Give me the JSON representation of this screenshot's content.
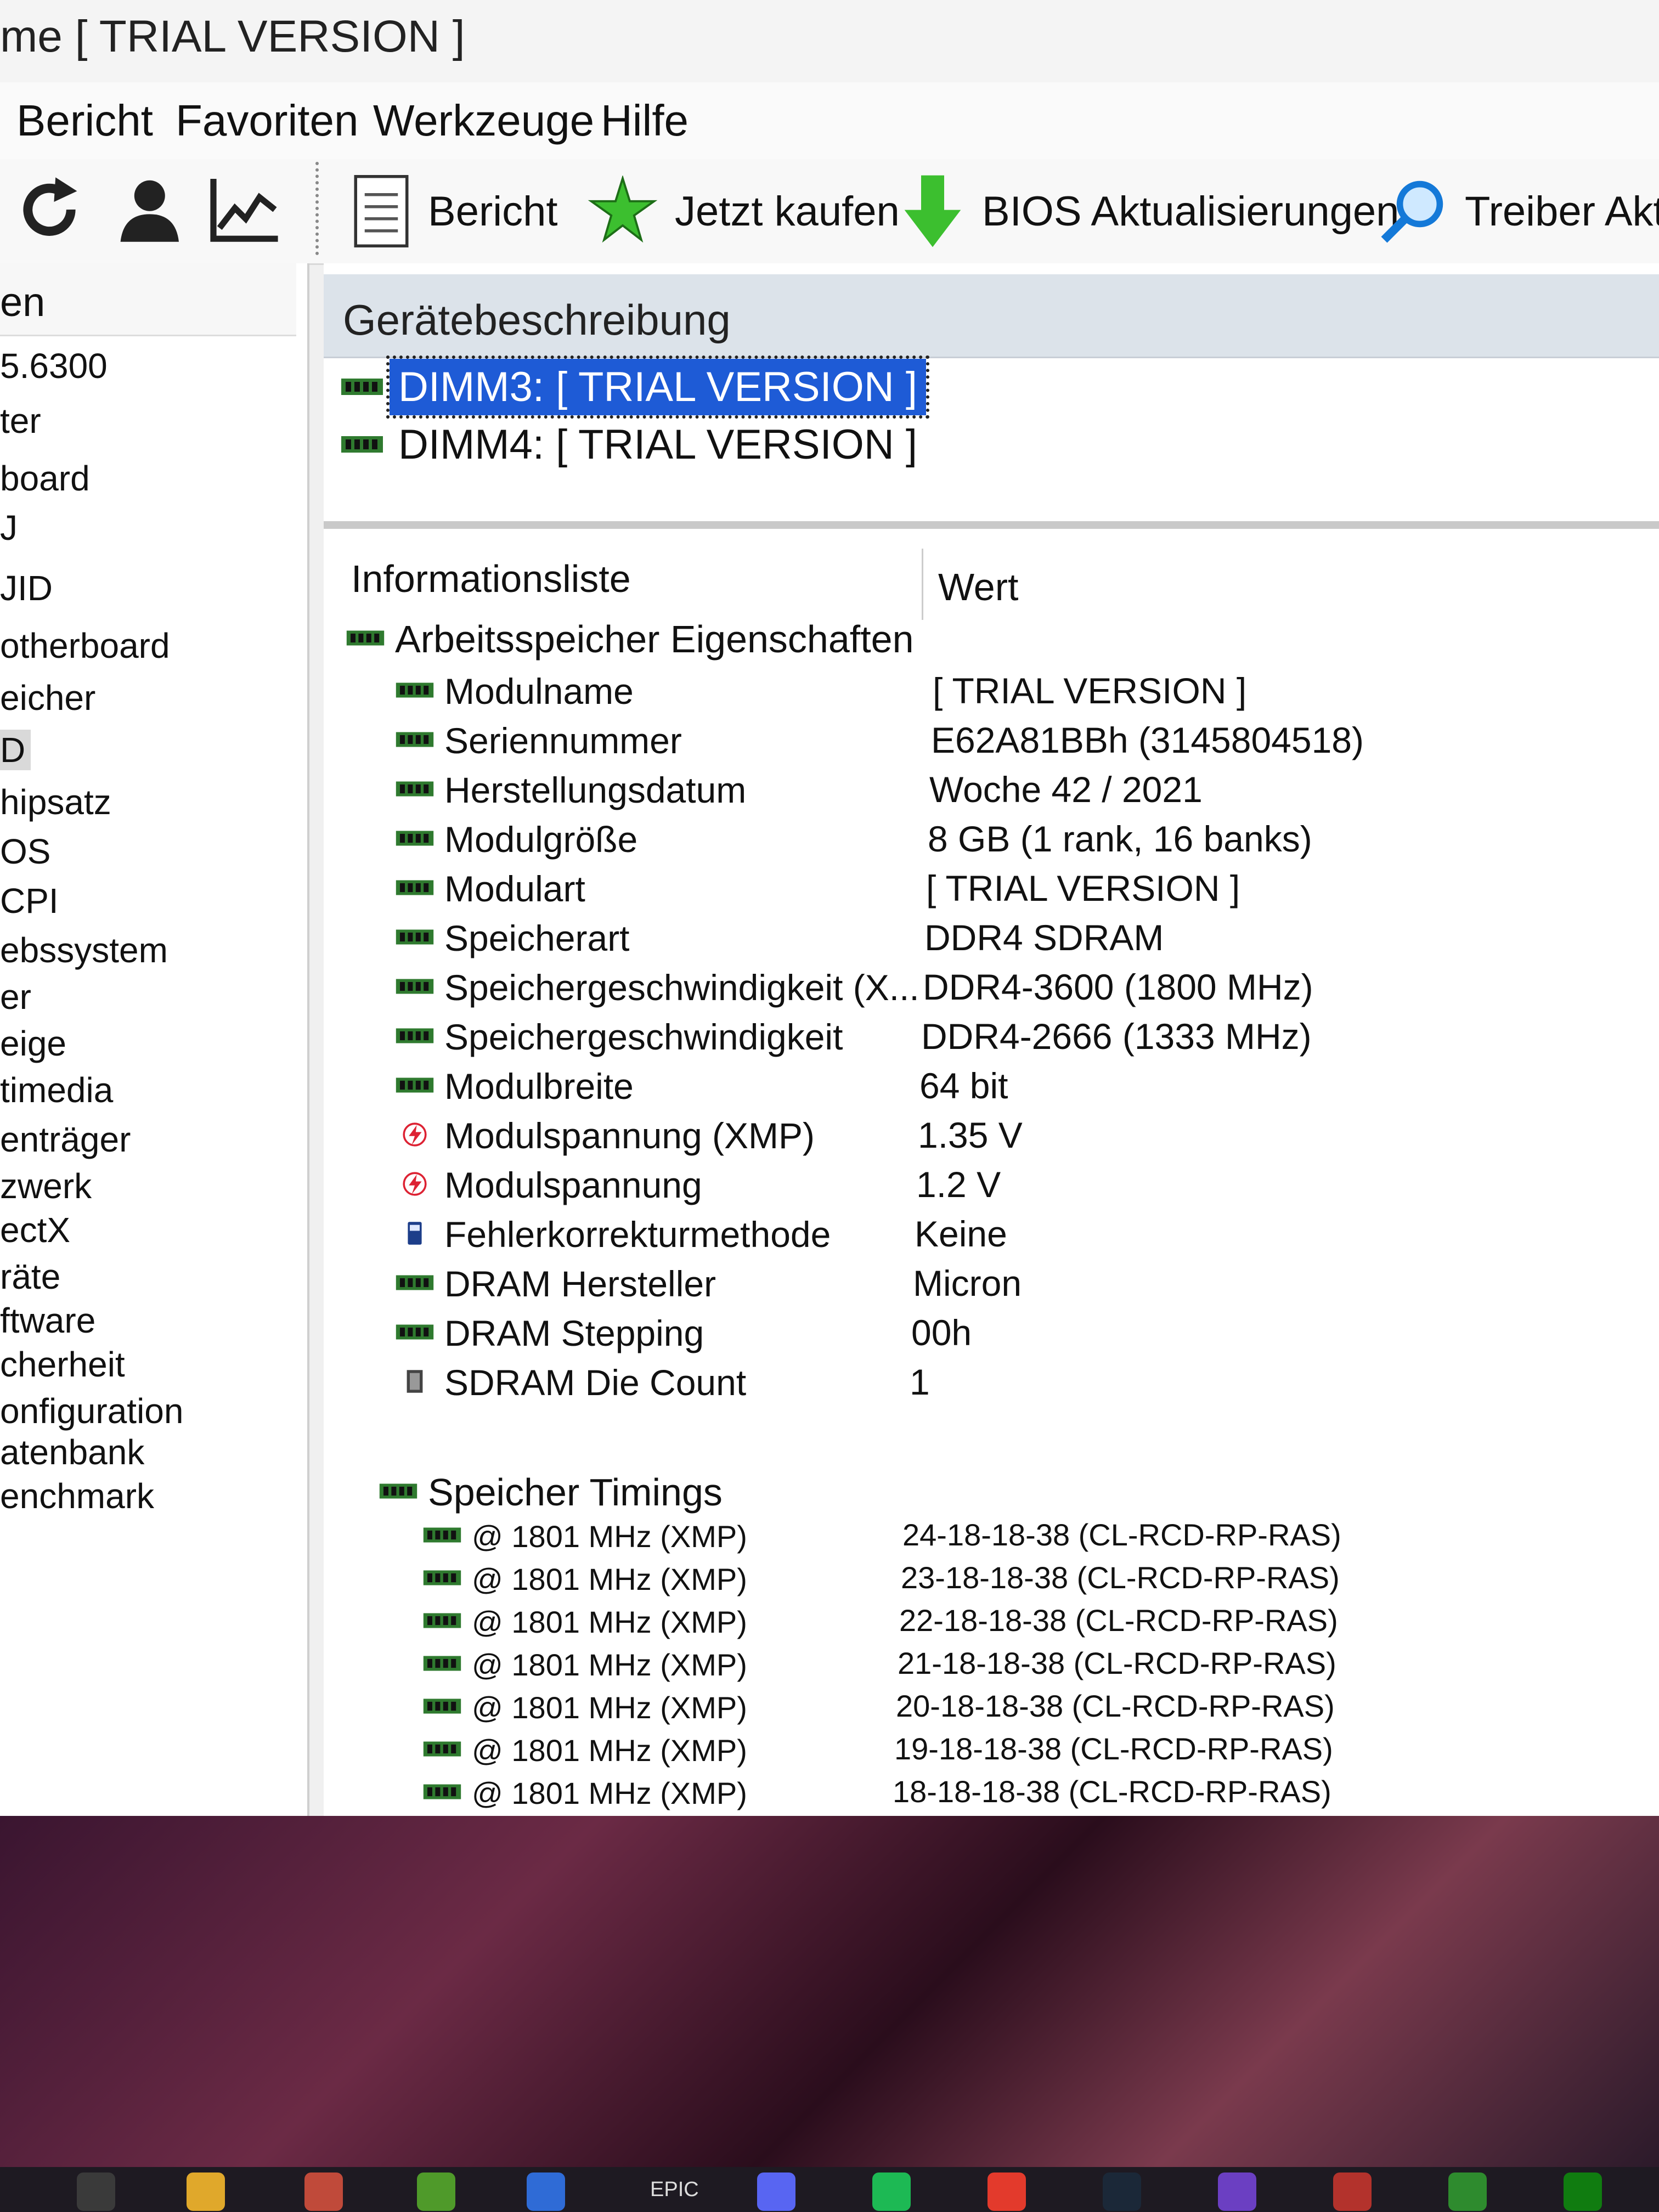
{
  "window": {
    "title": "me  [ TRIAL VERSION ]"
  },
  "menu": [
    "Bericht",
    "Favoriten",
    "Werkzeuge",
    "Hilfe"
  ],
  "toolbar": {
    "report": "Bericht",
    "buy": "Jetzt kaufen",
    "bios": "BIOS Aktualisierungen",
    "drivers": "Treiber Aktua"
  },
  "sidebar": {
    "header": "en",
    "items": [
      "5.6300",
      "ter",
      "board",
      "J",
      "JID",
      "otherboard",
      "eicher",
      "D",
      "hipsatz",
      "OS",
      "CPI",
      "ebssystem",
      "er",
      "eige",
      "timedia",
      "enträger",
      "zwerk",
      "ectX",
      "räte",
      "ftware",
      "cherheit",
      "onfiguration",
      "atenbank",
      "enchmark"
    ]
  },
  "devices": {
    "header": "Gerätebeschreibung",
    "items": [
      "DIMM3: [ TRIAL VERSION ]",
      "DIMM4: [ TRIAL VERSION ]"
    ]
  },
  "info": {
    "col1": "Informationsliste",
    "col2": "Wert",
    "group1": "Arbeitsspeicher Eigenschaften",
    "rows": [
      {
        "label": "Modulname",
        "value": "[ TRIAL VERSION ]",
        "icon": "memory-icon"
      },
      {
        "label": "Seriennummer",
        "value": "E62A81BBh (3145804518)",
        "icon": "memory-icon"
      },
      {
        "label": "Herstellungsdatum",
        "value": "Woche 42 / 2021",
        "icon": "memory-icon"
      },
      {
        "label": "Modulgröße",
        "value": "8 GB (1 rank, 16 banks)",
        "icon": "memory-icon"
      },
      {
        "label": "Modulart",
        "value": "[ TRIAL VERSION ]",
        "icon": "memory-icon"
      },
      {
        "label": "Speicherart",
        "value": "DDR4 SDRAM",
        "icon": "memory-icon"
      },
      {
        "label": "Speichergeschwindigkeit (X...",
        "value": "DDR4-3600 (1800 MHz)",
        "icon": "memory-icon"
      },
      {
        "label": "Speichergeschwindigkeit",
        "value": "DDR4-2666 (1333 MHz)",
        "icon": "memory-icon"
      },
      {
        "label": "Modulbreite",
        "value": "64 bit",
        "icon": "memory-icon"
      },
      {
        "label": "Modulspannung (XMP)",
        "value": "1.35 V",
        "icon": "voltage-icon"
      },
      {
        "label": "Modulspannung",
        "value": "1.2 V",
        "icon": "voltage-icon"
      },
      {
        "label": "Fehlerkorrekturmethode",
        "value": "Keine",
        "icon": "ecc-icon"
      },
      {
        "label": "DRAM Hersteller",
        "value": "Micron",
        "icon": "memory-icon"
      },
      {
        "label": "DRAM Stepping",
        "value": "00h",
        "icon": "memory-icon"
      },
      {
        "label": "SDRAM Die Count",
        "value": "1",
        "icon": "die-icon"
      }
    ],
    "group2": "Speicher Timings",
    "timings": [
      {
        "label": "@ 1801 MHz (XMP)",
        "value": "24-18-18-38  (CL-RCD-RP-RAS)"
      },
      {
        "label": "@ 1801 MHz (XMP)",
        "value": "23-18-18-38  (CL-RCD-RP-RAS)"
      },
      {
        "label": "@ 1801 MHz (XMP)",
        "value": "22-18-18-38  (CL-RCD-RP-RAS)"
      },
      {
        "label": "@ 1801 MHz (XMP)",
        "value": "21-18-18-38  (CL-RCD-RP-RAS)"
      },
      {
        "label": "@ 1801 MHz (XMP)",
        "value": "20-18-18-38  (CL-RCD-RP-RAS)"
      },
      {
        "label": "@ 1801 MHz (XMP)",
        "value": "19-18-18-38  (CL-RCD-RP-RAS)"
      },
      {
        "label": "@ 1801 MHz (XMP)",
        "value": "18-18-18-38  (CL-RCD-RP-RAS)"
      }
    ]
  },
  "taskbar": {
    "epic_label": "EPIC"
  },
  "colors": {
    "selection": "#1e5bd6",
    "panel_header": "#dce3ea",
    "toolbar_green": "#3cbf2f"
  }
}
